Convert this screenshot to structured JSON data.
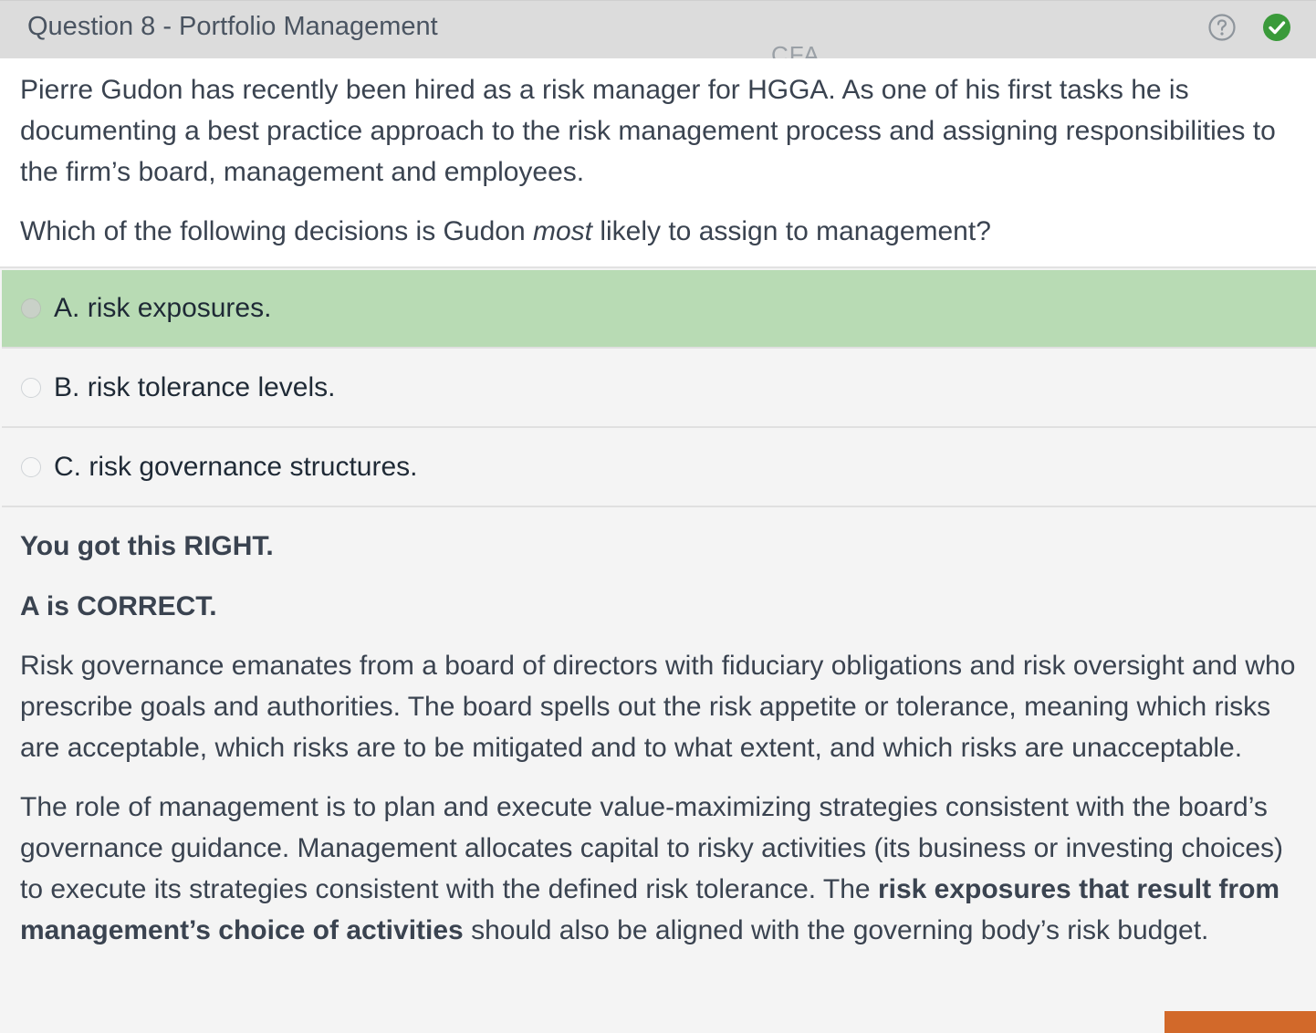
{
  "header": {
    "title": "Question 8 - Portfolio Management",
    "watermark": "CFA",
    "help_icon": "question-circle-icon",
    "status_icon": "check-circle-icon",
    "status_color": "#3a9a3a"
  },
  "question": {
    "stem": "Pierre Gudon has recently been hired as a risk manager for HGGA. As one of his first tasks he is documenting a best practice approach to the risk management process and assigning responsibilities to the firm’s board, management and employees.",
    "prompt_before": "Which of the following decisions is Gudon ",
    "prompt_emphasis": "most",
    "prompt_after": " likely to assign to management?"
  },
  "options": [
    {
      "letter": "A.",
      "text": "risk exposures.",
      "selected": true
    },
    {
      "letter": "B.",
      "text": "risk tolerance levels.",
      "selected": false
    },
    {
      "letter": "C.",
      "text": "risk governance structures.",
      "selected": false
    }
  ],
  "feedback": {
    "result": "You got this RIGHT.",
    "correct_answer": "A is CORRECT.",
    "paragraph1": "Risk governance emanates from a board of directors with fiduciary obligations and risk oversight and who prescribe goals and authorities.  The board spells out the risk appetite or tolerance, meaning which risks are acceptable, which risks are to be mitigated and to what extent, and which risks are unacceptable.",
    "paragraph2_before": "The role of management is to plan and execute value-maximizing strategies consistent with the board’s governance guidance.  Management allocates capital to risky activities (its business or investing choices) to execute its strategies consistent with the defined risk tolerance.  The ",
    "paragraph2_bold": "risk exposures that result from management’s choice of activities",
    "paragraph2_after": " should also be aligned with the governing body’s risk budget."
  },
  "colors": {
    "selected_option": "#b8dbb4",
    "header_bg": "#dcdcdc",
    "accent_tab": "#d2692a"
  }
}
